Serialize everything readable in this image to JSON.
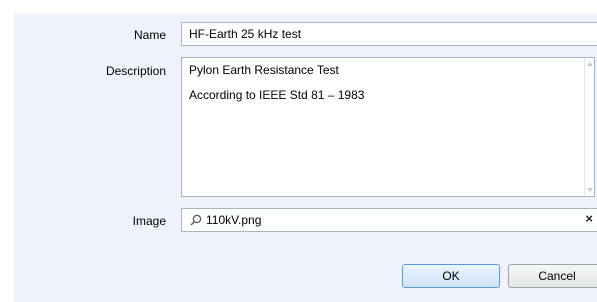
{
  "form": {
    "name_label": "Name",
    "name_value": "HF-Earth 25 kHz test",
    "description_label": "Description",
    "description_lines": [
      "Pylon Earth Resistance Test",
      "According to IEEE Std 81 – 1983"
    ],
    "image_label": "Image",
    "image_value": "110kV.png",
    "image_clear": "×"
  },
  "buttons": {
    "ok_label": "OK",
    "cancel_label": "Cancel"
  },
  "icons": {
    "image_field": "search-icon",
    "image_clear": "clear-icon"
  },
  "colors": {
    "panel_background": "#eef3fb",
    "field_border": "#a9b4c2",
    "ok_border": "#5b9bd5"
  }
}
